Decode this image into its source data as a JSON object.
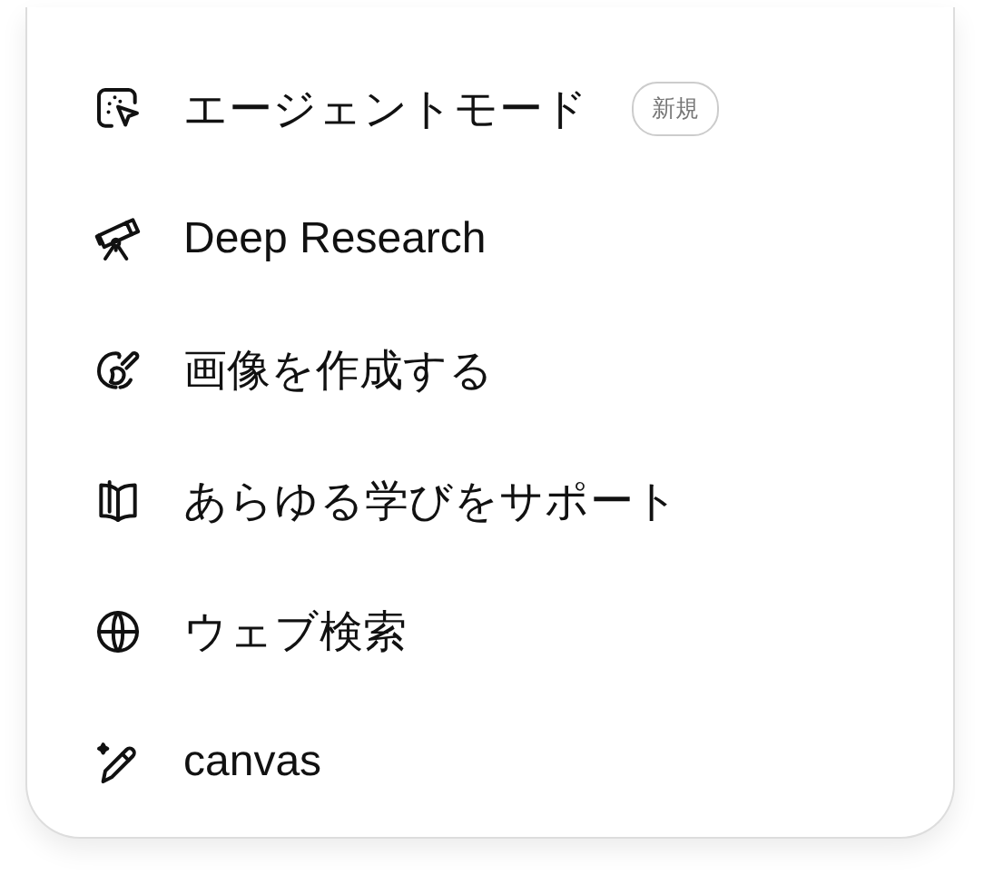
{
  "menu": {
    "items": [
      {
        "label": "エージェントモード",
        "badge": "新規"
      },
      {
        "label": "Deep Research"
      },
      {
        "label": "画像を作成する"
      },
      {
        "label": "あらゆる学びをサポート"
      },
      {
        "label": "ウェブ検索"
      },
      {
        "label": "canvas"
      }
    ]
  }
}
